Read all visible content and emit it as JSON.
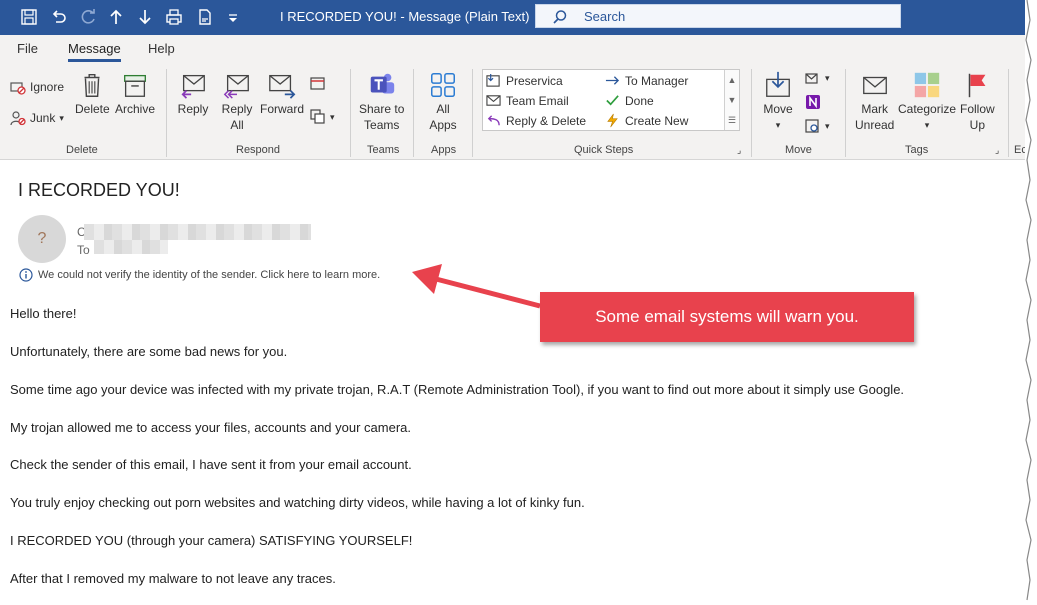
{
  "window": {
    "title": "I RECORDED YOU!  -  Message (Plain Text)",
    "search_placeholder": "Search"
  },
  "quick_access_icons": [
    "save-icon",
    "undo-icon",
    "redo-icon",
    "up-icon",
    "down-icon",
    "print-icon",
    "document-icon",
    "customize-icon"
  ],
  "tabs": [
    {
      "label": "File",
      "active": false
    },
    {
      "label": "Message",
      "active": true
    },
    {
      "label": "Help",
      "active": false
    }
  ],
  "ribbon": {
    "delete_group": {
      "label": "Delete",
      "ignore": "Ignore",
      "junk": "Junk",
      "delete": "Delete",
      "archive": "Archive"
    },
    "respond_group": {
      "label": "Respond",
      "reply": "Reply",
      "reply_all_1": "Reply",
      "reply_all_2": "All",
      "forward": "Forward"
    },
    "teams_group": {
      "label": "Teams",
      "share_1": "Share to",
      "share_2": "Teams"
    },
    "apps_group": {
      "label": "Apps",
      "all_1": "All",
      "all_2": "Apps"
    },
    "quicksteps_group": {
      "label": "Quick Steps",
      "items": [
        "Preservica",
        "To Manager",
        "Team Email",
        "Done",
        "Reply & Delete",
        "Create New"
      ]
    },
    "move_group": {
      "label": "Move",
      "move": "Move"
    },
    "tags_group": {
      "label": "Tags",
      "mark_1": "Mark",
      "mark_2": "Unread",
      "categorize": "Categorize",
      "follow_1": "Follow",
      "follow_2": "Up"
    },
    "cut_label": "Ec"
  },
  "message": {
    "subject": "I RECORDED YOU!",
    "avatar_glyph": "?",
    "from_initial": "C",
    "to_label": "To",
    "warning": "We could not verify the identity of the sender. Click here to learn more.",
    "paragraphs": [
      "Hello there!",
      "Unfortunately, there are some bad news for you.",
      "Some time ago your device was infected with my private trojan, R.A.T (Remote Administration Tool), if you want to find out more about it simply use Google.",
      "My trojan allowed me to access your files, accounts and your camera.",
      "Check the sender of this email, I have sent it from your email account.",
      "You truly enjoy checking out porn websites and watching dirty videos, while having a lot of kinky fun.",
      "I RECORDED YOU (through your camera) SATISFYING YOURSELF!",
      "After that I removed my malware to not leave any traces."
    ]
  },
  "callout": {
    "text": "Some email systems will warn you."
  },
  "colors": {
    "titlebar": "#2b579a",
    "ribbon": "#f3f2f1",
    "callout": "#e8424d",
    "accent": "#2b579a"
  }
}
